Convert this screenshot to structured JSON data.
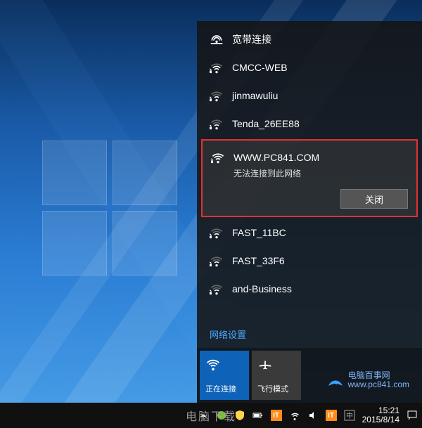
{
  "networks": [
    {
      "name": "宽带连接",
      "type": "wired",
      "strength": 4,
      "secure": false,
      "selected": false
    },
    {
      "name": "CMCC-WEB",
      "type": "wifi",
      "strength": 3,
      "secure": true,
      "selected": false
    },
    {
      "name": "jinmawuliu",
      "type": "wifi",
      "strength": 2,
      "secure": true,
      "selected": false
    },
    {
      "name": "Tenda_26EE88",
      "type": "wifi",
      "strength": 2,
      "secure": true,
      "selected": false
    },
    {
      "name": "WWW.PC841.COM",
      "type": "wifi",
      "strength": 4,
      "secure": true,
      "selected": true,
      "error": "无法连接到此网络",
      "close_label": "关闭"
    },
    {
      "name": "FAST_11BC",
      "type": "wifi",
      "strength": 2,
      "secure": true,
      "selected": false
    },
    {
      "name": "FAST_33F6",
      "type": "wifi",
      "strength": 2,
      "secure": true,
      "selected": false
    },
    {
      "name": "and-Business",
      "type": "wifi",
      "strength": 2,
      "secure": true,
      "selected": false
    }
  ],
  "network_settings_label": "网络设置",
  "tiles": {
    "wifi": {
      "label": "正在连接",
      "active": true
    },
    "airplane": {
      "label": "飞行模式",
      "active": false
    }
  },
  "watermark": {
    "line1": "电脑百事网",
    "line2": "www.pc841.com"
  },
  "bottom_text": "电脑下载",
  "taskbar": {
    "time": "15:21",
    "date": "2015/8/14"
  }
}
